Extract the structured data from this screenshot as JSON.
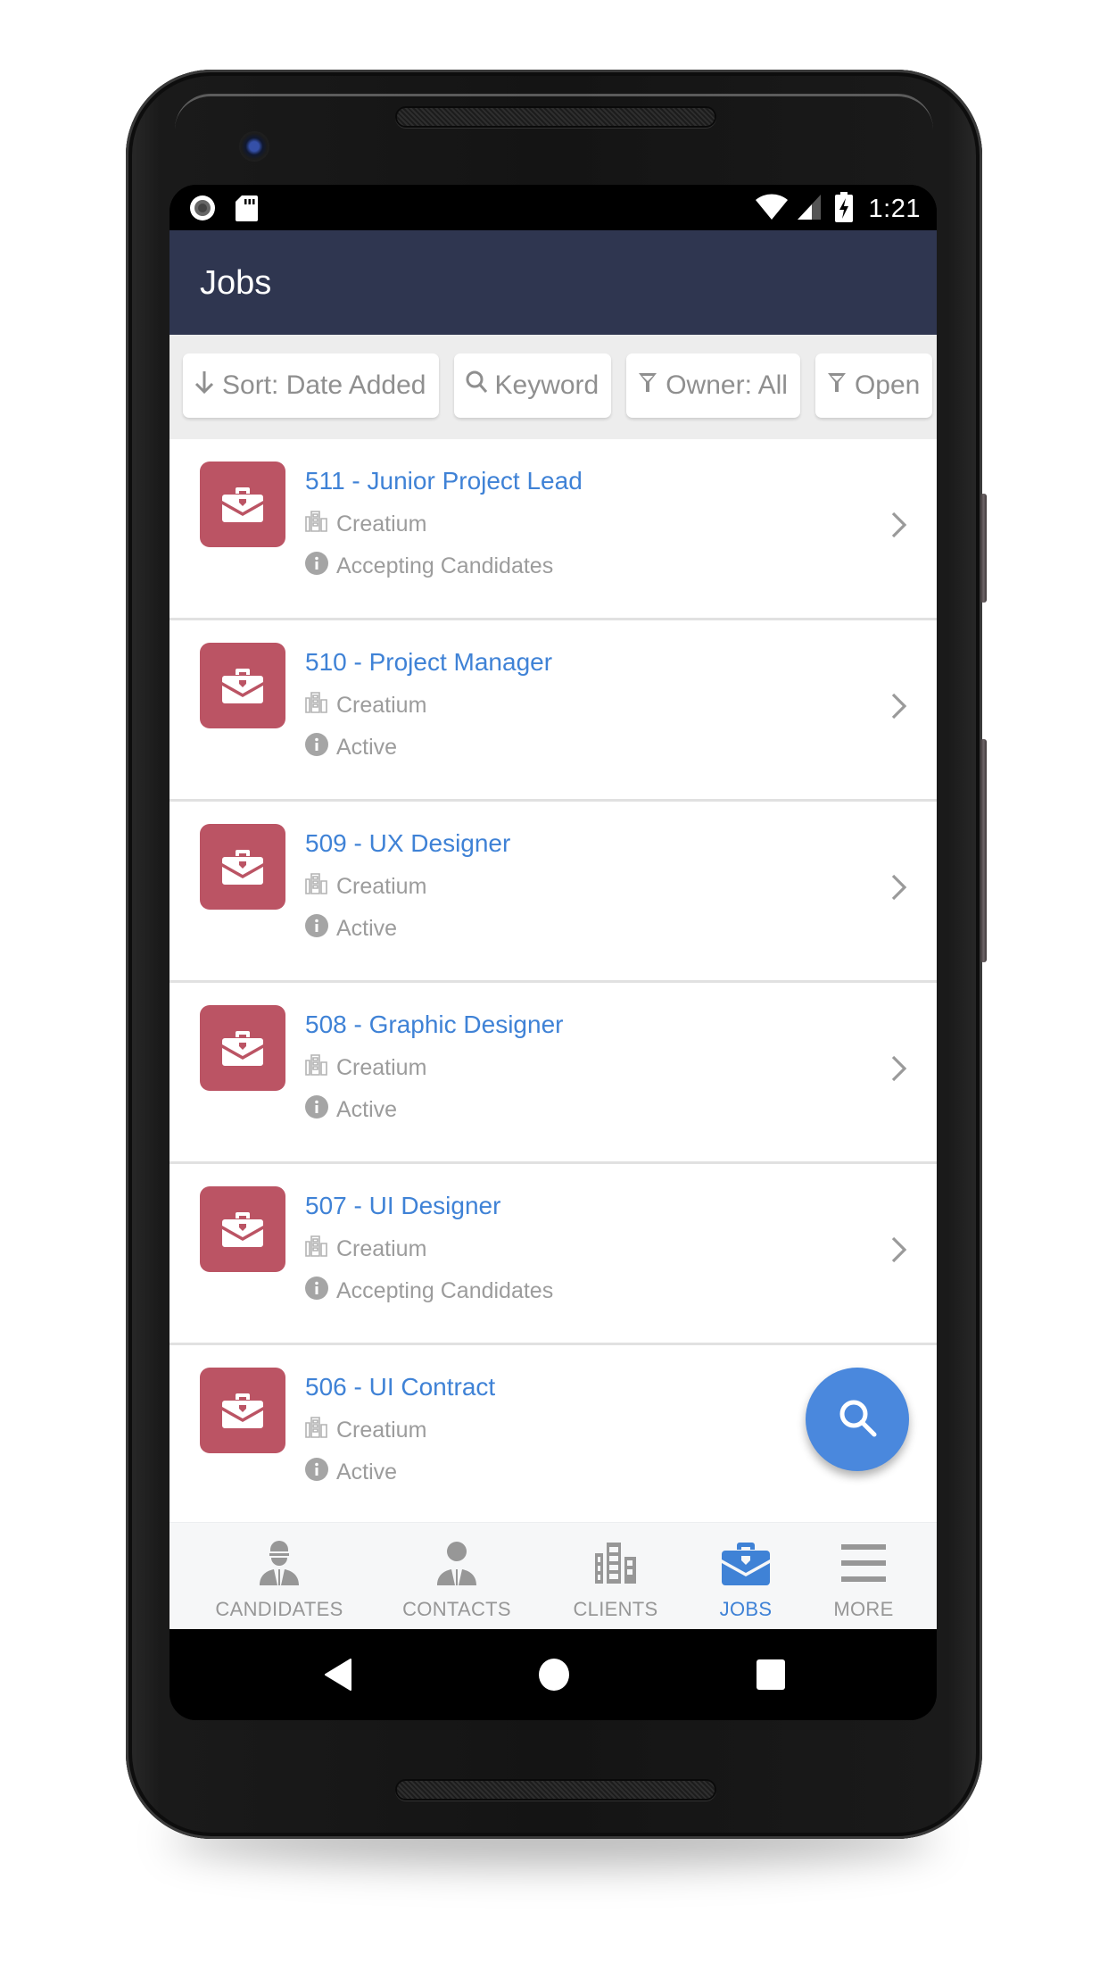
{
  "status_bar": {
    "time": "1:21",
    "left_icons": [
      "record-icon",
      "sd-card-icon"
    ],
    "right_icons": [
      "wifi-icon",
      "cell-signal-icon",
      "battery-charging-icon"
    ]
  },
  "app_bar": {
    "title": "Jobs"
  },
  "filters": [
    {
      "icon": "arrow-down-icon",
      "label": "Sort: Date Added"
    },
    {
      "icon": "search-icon",
      "label": "Keyword"
    },
    {
      "icon": "filter-icon",
      "label": "Owner: All"
    },
    {
      "icon": "filter-icon",
      "label": "Open"
    }
  ],
  "jobs": [
    {
      "title": "511 - Junior Project Lead",
      "client": "Creatium",
      "status": "Accepting Candidates"
    },
    {
      "title": "510 - Project Manager",
      "client": "Creatium",
      "status": "Active"
    },
    {
      "title": "509 - UX Designer",
      "client": "Creatium",
      "status": "Active"
    },
    {
      "title": "508 - Graphic Designer",
      "client": "Creatium",
      "status": "Active"
    },
    {
      "title": "507 - UI Designer",
      "client": "Creatium",
      "status": "Accepting Candidates"
    },
    {
      "title": "506 - UI Contract",
      "client": "Creatium",
      "status": "Active"
    }
  ],
  "fab": {
    "icon": "search-icon"
  },
  "bottom_nav": {
    "active": "JOBS",
    "items": [
      {
        "label": "CANDIDATES",
        "icon": "candidate-icon"
      },
      {
        "label": "CONTACTS",
        "icon": "contact-icon"
      },
      {
        "label": "CLIENTS",
        "icon": "building-icon"
      },
      {
        "label": "JOBS",
        "icon": "briefcase-icon"
      },
      {
        "label": "MORE",
        "icon": "menu-icon"
      }
    ]
  },
  "colors": {
    "app_bar": "#2f3650",
    "accent": "#3f82d6",
    "fab": "#4a88dd",
    "job_tile": "#bb5464",
    "muted_text": "#9c9c9c"
  }
}
